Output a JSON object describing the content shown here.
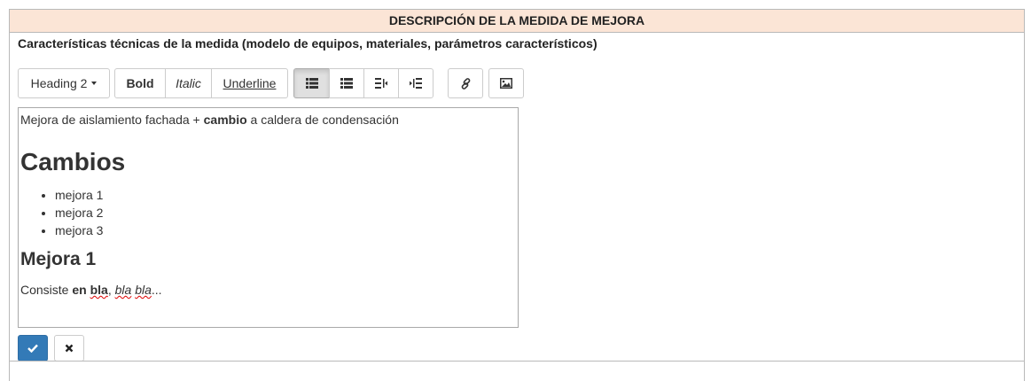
{
  "panel": {
    "title": "DESCRIPCIÓN DE LA MEDIDA DE MEJORA",
    "subtitle": "Características técnicas de la medida (modelo de equipos, materiales, parámetros característicos)"
  },
  "toolbar": {
    "heading_dropdown": "Heading 2",
    "bold": "Bold",
    "italic": "Italic",
    "underline": "Underline",
    "icons": [
      "list-ul-icon",
      "list-ol-icon",
      "outdent-icon",
      "indent-icon",
      "link-icon",
      "image-icon"
    ]
  },
  "editor": {
    "intro_before": "Mejora de aislamiento fachada + ",
    "intro_bold": "cambio",
    "intro_after": " a caldera de condensación",
    "heading1": "Cambios",
    "list": [
      "mejora 1",
      "mejora 2",
      "mejora 3"
    ],
    "heading2": "Mejora 1",
    "para_start": "Consiste ",
    "para_bold1": "en ",
    "para_bold2": "bla",
    "para_comma": ", ",
    "para_italic1": "bla",
    "para_space": " ",
    "para_italic2": "bla",
    "para_end": "..."
  },
  "actions": {
    "save_icon": "check-icon",
    "cancel_icon": "close-icon"
  },
  "colors": {
    "header_bg": "#fbe5d6",
    "primary": "#337ab7"
  }
}
